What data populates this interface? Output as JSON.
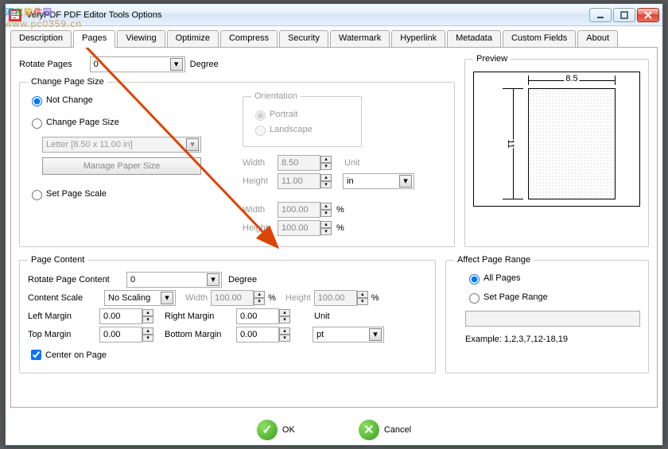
{
  "window": {
    "title": "VeryPDF PDF Editor Tools Options"
  },
  "tabs": [
    "Description",
    "Pages",
    "Viewing",
    "Optimize",
    "Compress",
    "Security",
    "Watermark",
    "Hyperlink",
    "Metadata",
    "Custom Fields",
    "About"
  ],
  "active_tab": "Pages",
  "rotate": {
    "label": "Rotate Pages",
    "value": "0",
    "unit": "Degree"
  },
  "change_size": {
    "legend": "Change Page Size",
    "opt_notchange": "Not Change",
    "opt_change": "Change Page Size",
    "opt_scale": "Set Page Scale",
    "paper_preset": "Letter [8.50 x 11.00 in]",
    "manage_btn": "Manage Paper Size",
    "orientation": {
      "legend": "Orientation",
      "portrait": "Portrait",
      "landscape": "Landscape"
    },
    "width_label": "Width",
    "width_val": "8.50",
    "height_label": "Height",
    "height_val": "11.00",
    "unit_label": "Unit",
    "unit_val": "in",
    "scale_w_label": "Width",
    "scale_w_val": "100.00",
    "scale_w_unit": "%",
    "scale_h_label": "Height",
    "scale_h_val": "100.00",
    "scale_h_unit": "%"
  },
  "preview": {
    "legend": "Preview",
    "w": "8.5",
    "h": "11"
  },
  "content": {
    "legend": "Page Content",
    "rotate_label": "Rotate Page Content",
    "rotate_val": "0",
    "rotate_unit": "Degree",
    "scale_label": "Content Scale",
    "scale_val": "No Scaling",
    "w_label": "Width",
    "w_val": "100.00",
    "w_unit": "%",
    "h_label": "Height",
    "h_val": "100.00",
    "h_unit": "%",
    "lm": "Left Margin",
    "lm_v": "0.00",
    "rm": "Right Margin",
    "rm_v": "0.00",
    "tm": "Top Margin",
    "tm_v": "0.00",
    "bm": "Bottom Margin",
    "bm_v": "0.00",
    "unit_label": "Unit",
    "unit_val": "pt",
    "center": "Center on Page"
  },
  "range": {
    "legend": "Affect Page Range",
    "all": "All Pages",
    "set": "Set Page Range",
    "input": "",
    "example": "Example: 1,2,3,7,12-18,19"
  },
  "footer": {
    "ok": "OK",
    "cancel": "Cancel"
  },
  "watermark": {
    "cn": "河东软件园",
    "url": "www.pc0359.cn"
  }
}
